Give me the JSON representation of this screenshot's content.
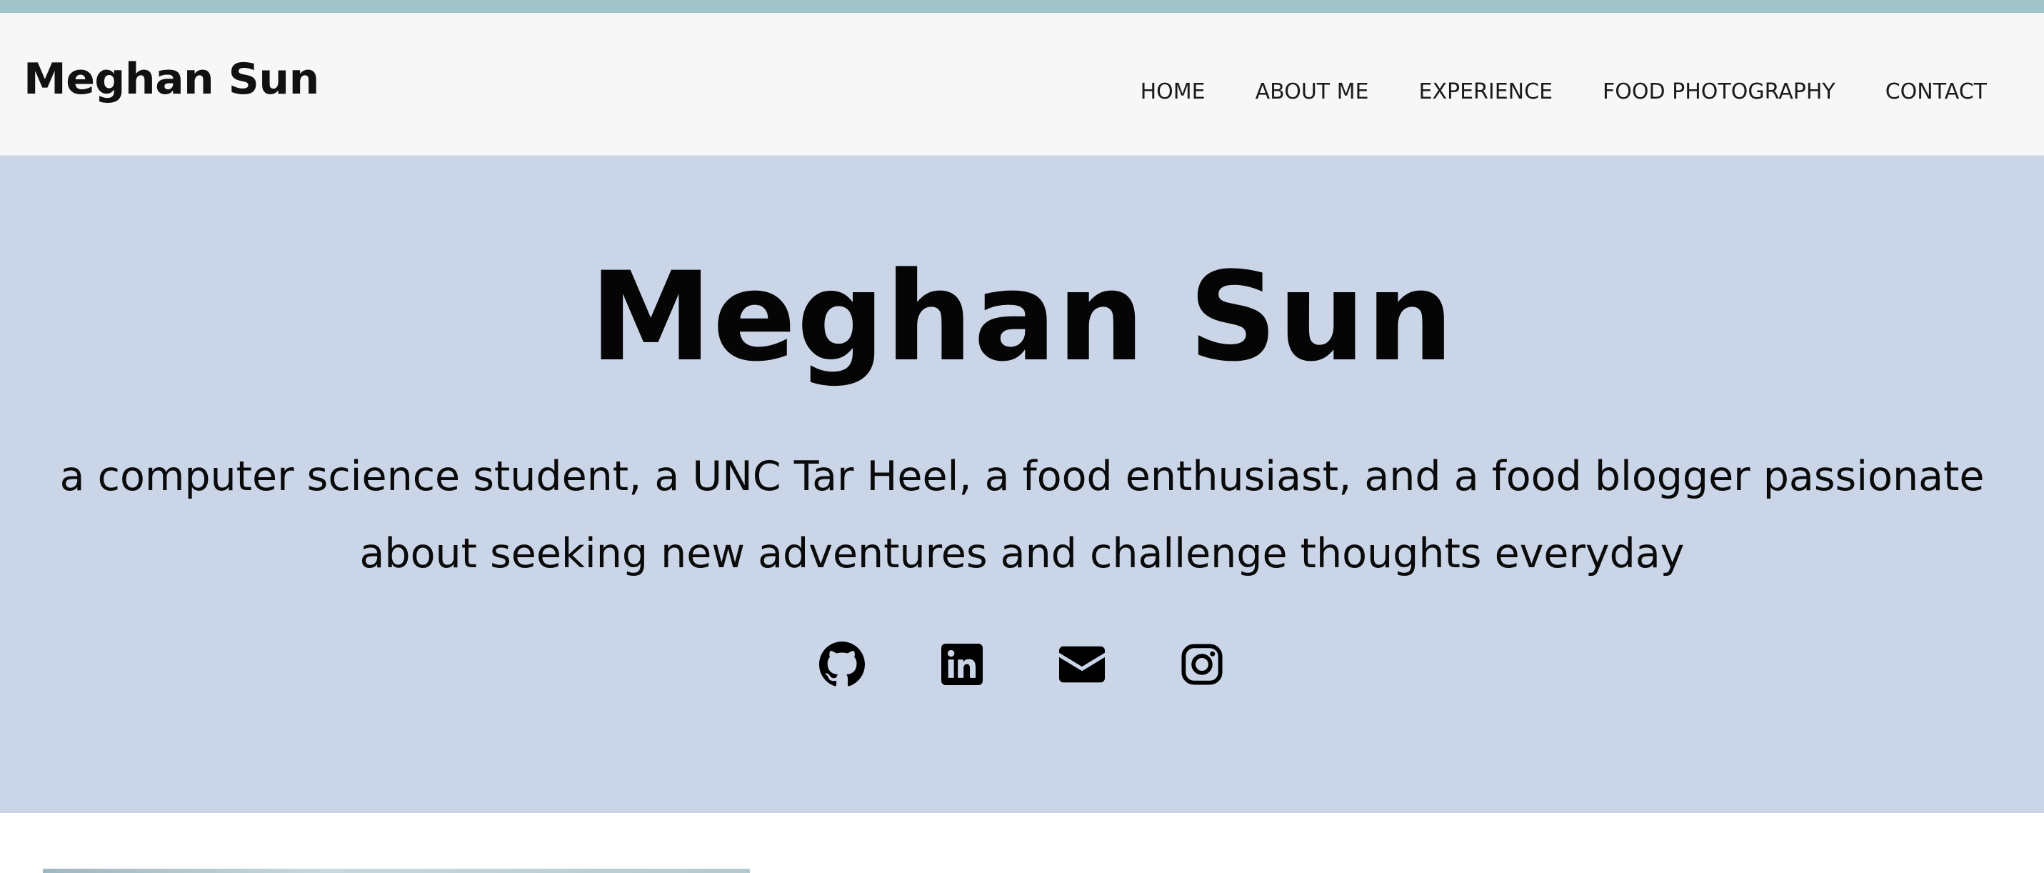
{
  "header": {
    "brand": "Meghan Sun",
    "nav": [
      {
        "label": "HOME"
      },
      {
        "label": "ABOUT ME"
      },
      {
        "label": "EXPERIENCE"
      },
      {
        "label": "FOOD PHOTOGRAPHY"
      },
      {
        "label": "CONTACT"
      }
    ]
  },
  "hero": {
    "title": "Meghan Sun",
    "tagline": "a computer science student, a UNC Tar Heel, a food enthusiast, and a food blogger passionate about seeking new adventures and challenge thoughts everyday",
    "social_icons": [
      "github-icon",
      "linkedin-icon",
      "email-icon",
      "instagram-icon"
    ]
  },
  "colors": {
    "top_strip": "#a2c5c9",
    "navbar_bg": "#f7f7f7",
    "hero_bg": "#cad5e7",
    "text": "#111111"
  }
}
